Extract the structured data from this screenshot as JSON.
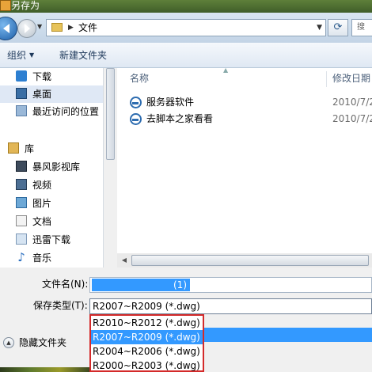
{
  "window": {
    "title": "另存为"
  },
  "nav": {
    "breadcrumb": "文件",
    "search_placeholder": "搜"
  },
  "toolbar": {
    "organize": "组织",
    "new_folder": "新建文件夹"
  },
  "sidebar": {
    "favorites": [
      {
        "label": "下载",
        "icon": "download-folder-icon"
      },
      {
        "label": "桌面",
        "icon": "desktop-icon",
        "selected": true
      },
      {
        "label": "最近访问的位置",
        "icon": "recent-places-icon"
      }
    ],
    "library": {
      "label": "库",
      "icon": "library-icon"
    },
    "library_items": [
      {
        "label": "暴风影视库",
        "icon": "video-library-icon"
      },
      {
        "label": "视频",
        "icon": "videos-icon"
      },
      {
        "label": "图片",
        "icon": "pictures-icon"
      },
      {
        "label": "文档",
        "icon": "documents-icon"
      },
      {
        "label": "迅雷下载",
        "icon": "xunlei-download-icon"
      },
      {
        "label": "音乐",
        "icon": "music-icon"
      }
    ]
  },
  "file_list": {
    "columns": {
      "name": "名称",
      "modified": "修改日期"
    },
    "rows": [
      {
        "name": "服务器软件",
        "date": "2010/7/2"
      },
      {
        "name": "去脚本之家看看",
        "date": "2010/7/2"
      }
    ]
  },
  "form": {
    "filename_label": "文件名(N):",
    "filename_value": "(1)",
    "filetype_label": "保存类型(T):",
    "filetype_value": "R2007~R2009 (*.dwg)",
    "hide_folders": "隐藏文件夹"
  },
  "dropdown": {
    "options": [
      "R2010~R2012 (*.dwg)",
      "R2007~R2009 (*.dwg)",
      "R2004~R2006 (*.dwg)",
      "R2000~R2003 (*.dwg)"
    ],
    "selected_index": 1
  },
  "colors": {
    "selection": "#3399ff",
    "highlight_border": "#d42a2a",
    "titlebar": "#4f6e32"
  }
}
